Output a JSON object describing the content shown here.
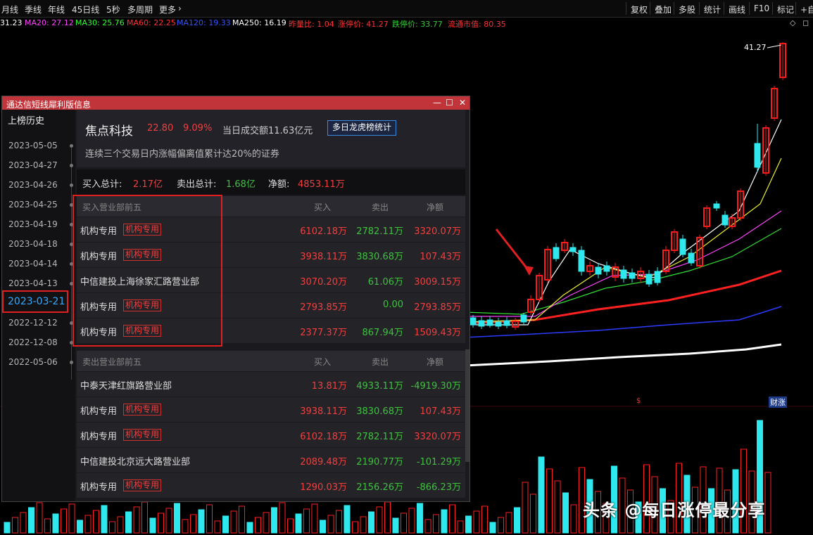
{
  "periods": [
    "月线",
    "季线",
    "年线",
    "45日线",
    "5秒",
    "多周期",
    "更多"
  ],
  "tools": [
    "复权",
    "叠加",
    "多股",
    "统计",
    "画线",
    "F10",
    "标记",
    "+自"
  ],
  "ma_bar": [
    {
      "text": "31.23",
      "color": "#ffffff"
    },
    {
      "text": "MA20: 27.12",
      "color": "#ff44ff"
    },
    {
      "text": "MA30: 25.76",
      "color": "#33ff33"
    },
    {
      "text": "MA60: 22.25",
      "color": "#ff3333"
    },
    {
      "text": "MA120: 19.33",
      "color": "#3355ff"
    },
    {
      "text": "MA250: 16.19",
      "color": "#ffffff"
    },
    {
      "text": "昨量比: 1.04",
      "color": "#ff3333"
    },
    {
      "text": "涨停价: 41.27",
      "color": "#ff3333"
    },
    {
      "text": "跌停价: 33.77",
      "color": "#33cc33"
    },
    {
      "text": "流通市值: 80.35",
      "color": "#ff3333"
    }
  ],
  "price_label": "41.27",
  "finance_badge": "财涨",
  "dollar_mark": "$",
  "watermark": "头条 @每日涨停最分享",
  "panel": {
    "title": "通达信短线犀利版信息",
    "history_title": "上榜历史",
    "dates": [
      "2023-05-05",
      "2023-04-27",
      "2023-04-26",
      "2023-04-25",
      "2023-04-19",
      "2023-04-18",
      "2023-04-14",
      "2023-04-13",
      "2023-03-21",
      "2022-12-12",
      "2022-12-08",
      "2022-05-06"
    ],
    "selected_date": "2023-03-21",
    "stock": {
      "name": "焦点科技",
      "price": "22.80",
      "change": "9.09%",
      "amount": "当日成交额11.63亿元",
      "button": "多日龙虎榜统计",
      "reason": "连续三个交易日内涨幅偏离值累计达20%的证券"
    },
    "summary": {
      "buy_label": "买入总计:",
      "buy_value": "2.17亿",
      "sell_label": "卖出总计:",
      "sell_value": "1.68亿",
      "net_label": "净额:",
      "net_value": "4853.11万"
    },
    "buy_table": {
      "header": [
        "买入营业部前五",
        "买入",
        "卖出",
        "净额"
      ],
      "rows": [
        {
          "name": "机构专用",
          "tag": "机构专用",
          "buy": "6102.18万",
          "sell": "2782.11万",
          "net": "3320.07万",
          "net_color": "red"
        },
        {
          "name": "机构专用",
          "tag": "机构专用",
          "buy": "3938.11万",
          "sell": "3830.68万",
          "net": "107.43万",
          "net_color": "red"
        },
        {
          "name": "中信建投上海徐家汇路营业部",
          "tag": "",
          "buy": "3070.20万",
          "sell": "61.06万",
          "net": "3009.15万",
          "net_color": "red"
        },
        {
          "name": "机构专用",
          "tag": "机构专用",
          "buy": "2793.85万",
          "sell": "0.00",
          "net": "2793.85万",
          "net_color": "red"
        },
        {
          "name": "机构专用",
          "tag": "机构专用",
          "buy": "2377.37万",
          "sell": "867.94万",
          "net": "1509.43万",
          "net_color": "red"
        }
      ]
    },
    "sell_table": {
      "header": [
        "卖出营业部前五",
        "买入",
        "卖出",
        "净额"
      ],
      "rows": [
        {
          "name": "中泰天津红旗路营业部",
          "tag": "",
          "buy": "13.81万",
          "sell": "4933.11万",
          "net": "-4919.30万",
          "net_color": "green"
        },
        {
          "name": "机构专用",
          "tag": "机构专用",
          "buy": "3938.11万",
          "sell": "3830.68万",
          "net": "107.43万",
          "net_color": "red"
        },
        {
          "name": "机构专用",
          "tag": "机构专用",
          "buy": "6102.18万",
          "sell": "2782.11万",
          "net": "3320.07万",
          "net_color": "red"
        },
        {
          "name": "中信建投北京远大路营业部",
          "tag": "",
          "buy": "2089.48万",
          "sell": "2190.77万",
          "net": "-101.29万",
          "net_color": "green"
        },
        {
          "name": "机构专用",
          "tag": "机构专用",
          "buy": "1290.03万",
          "sell": "2156.26万",
          "net": "-866.23万",
          "net_color": "green"
        }
      ]
    }
  }
}
